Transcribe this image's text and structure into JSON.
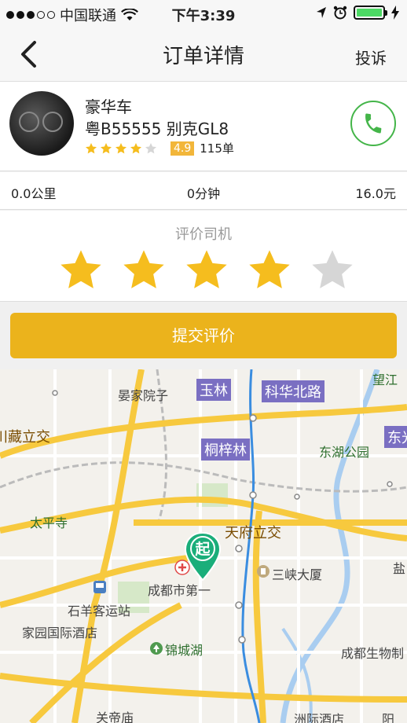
{
  "status_bar": {
    "carrier": "中国联通",
    "time": "下午3:39"
  },
  "nav": {
    "title": "订单详情",
    "complain_label": "投诉"
  },
  "driver": {
    "car_type": "豪华车",
    "plate_model": "粤B55555 别克GL8",
    "star_rating": 4,
    "score": "4.9",
    "orders": "115单"
  },
  "trip": {
    "distance": "0.0公里",
    "duration": "0分钟",
    "fare": "16.0元"
  },
  "rating": {
    "label": "评价司机",
    "selected_stars": 4,
    "max_stars": 5
  },
  "submit_label": "提交评价",
  "colors": {
    "accent": "#ebb31c",
    "star_on": "#f5bd1e",
    "star_off": "#d6d6d6",
    "phone_green": "#44b549",
    "marker_green": "#1aae7a",
    "metro_purple": "#7a6fc2"
  },
  "map": {
    "start_marker": "起",
    "labels": {
      "yanjia": "晏家院子",
      "wangjiang": "望江",
      "zangli": "川藏立交",
      "donghu": "东湖公园",
      "dongguang": "东光",
      "taiping": "太平寺",
      "tianfu": "天府立交",
      "sanxia": "三峡大厦",
      "yan": "盐",
      "hospital": "成都市第一",
      "shiyang": "石羊客运站",
      "jiayuan": "家园国际酒店",
      "jincheng": "锦城湖",
      "bio": "成都生物制",
      "guandi": "关帝庙",
      "zhouji": "洲际酒店",
      "yang": "阳"
    },
    "metro": {
      "yulin": "玉林",
      "kehua": "科华北路",
      "tongzilin": "桐梓林"
    }
  }
}
